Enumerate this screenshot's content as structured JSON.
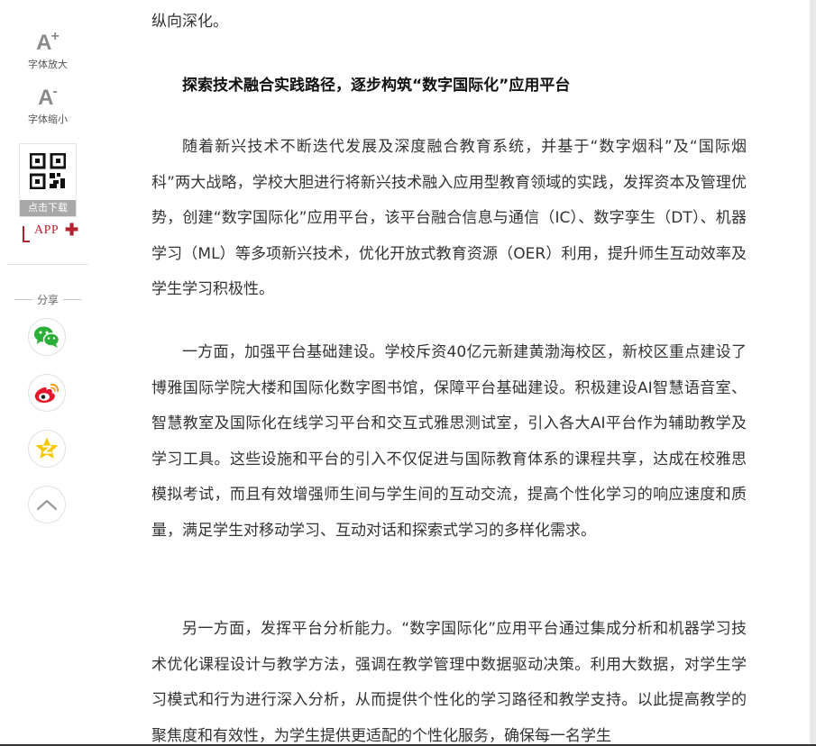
{
  "sidebar": {
    "font_increase": {
      "glyph": "A",
      "sup": "+",
      "label": "字体放大"
    },
    "font_decrease": {
      "glyph": "A",
      "sup": "-",
      "label": "字体缩小"
    },
    "qr": {
      "caption": "点击下载"
    },
    "app_badge": {
      "text": "APP"
    },
    "share_label": "分享",
    "share_buttons": [
      {
        "icon": "wechat-icon",
        "color": "#2aae38"
      },
      {
        "icon": "weibo-icon",
        "color": "#e6162d"
      },
      {
        "icon": "qzone-icon",
        "color": "#f7c600"
      }
    ],
    "back_to_top_icon": "chevron-up-icon"
  },
  "article": {
    "lead_in": "纵向深化。",
    "heading": "探索技术融合实践路径，逐步构筑“数字国际化”应用平台",
    "paragraphs": [
      "随着新兴技术不断迭代发展及深度融合教育系统，并基于“数字烟科”及“国际烟科”两大战略，学校大胆进行将新兴技术融入应用型教育领域的实践，发挥资本及管理优势，创建“数字国际化”应用平台，该平台融合信息与通信（IC）、数字孪生（DT）、机器学习（ML）等多项新兴技术，优化开放式教育资源（OER）利用，提升师生互动效率及学生学习积极性。",
      "一方面，加强平台基础建设。学校斥资40亿元新建黄渤海校区，新校区重点建设了博雅国际学院大楼和国际化数字图书馆，保障平台基础建设。积极建设AI智慧语音室、智慧教室及国际化在线学习平台和交互式雅思测试室，引入各大AI平台作为辅助教学及学习工具。这些设施和平台的引入不仅促进与国际教育体系的课程共享，达成在校雅思模拟考试，而且有效增强师生间与学生间的互动交流，提高个性化学习的响应速度和质量，满足学生对移动学习、互动对话和探索式学习的多样化需求。",
      "另一方面，发挥平台分析能力。“数字国际化”应用平台通过集成分析和机器学习技术优化课程设计与教学方法，强调在教学管理中数据驱动决策。利用大数据，对学生学习模式和行为进行深入分析，从而提供个性化的学习路径和教学支持。以此提高教学的聚焦度和有效性，为学生提供更适配的个性化服务，确保每一名学生"
    ]
  }
}
